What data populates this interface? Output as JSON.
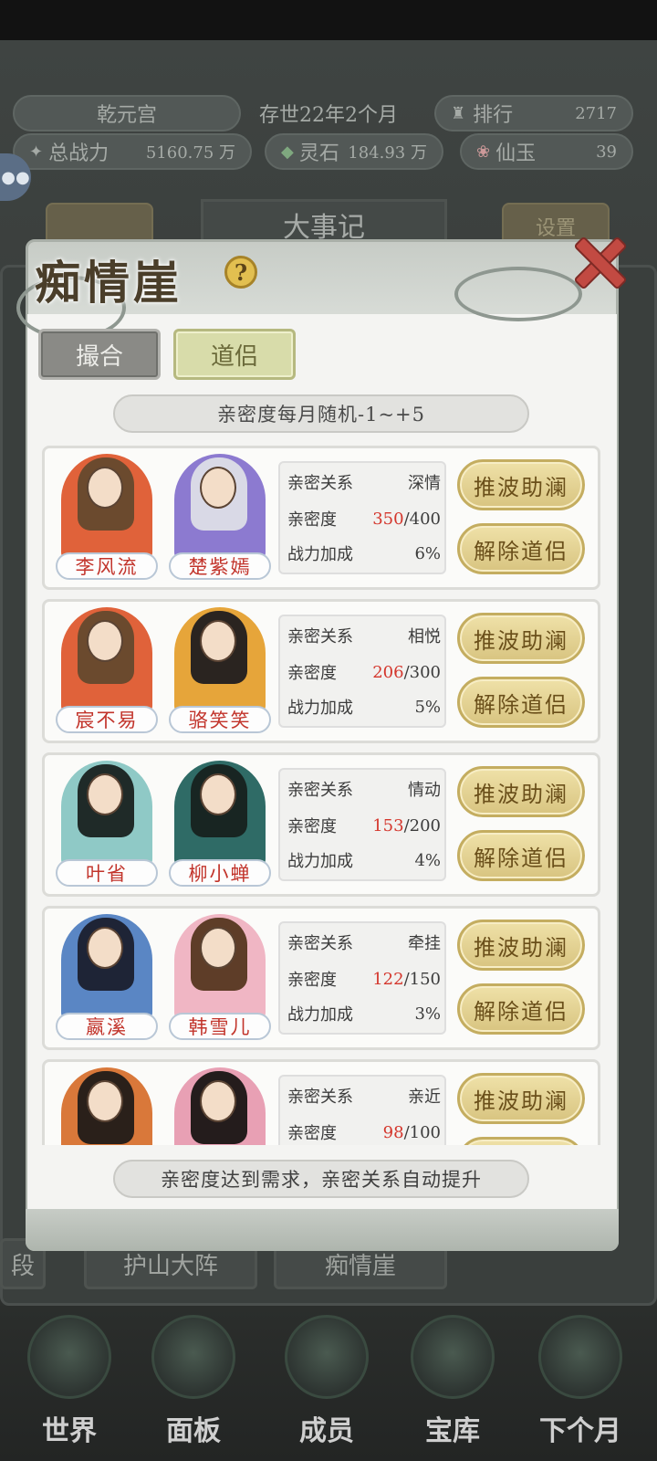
{
  "topbar": {
    "sect_name": "乾元宫",
    "era": "存世22年2个月",
    "rank_label": "排行",
    "rank_value": "2717",
    "power_label": "总战力",
    "power_value": "5160.75 万",
    "stone_label": "灵石",
    "stone_value": "184.93 万",
    "jade_label": "仙玉",
    "jade_value": "39"
  },
  "background": {
    "title": "大事记",
    "settings_label": "设置",
    "bottom_buttons": [
      "段",
      "护山大阵",
      "痴情崖"
    ]
  },
  "navbar": {
    "items": [
      {
        "label": "世界",
        "icon": "world-icon"
      },
      {
        "label": "面板",
        "icon": "panel-icon"
      },
      {
        "label": "成员",
        "icon": "members-icon"
      },
      {
        "label": "宝库",
        "icon": "treasury-icon"
      },
      {
        "label": "下个月",
        "icon": "next-month-icon"
      }
    ]
  },
  "dialog": {
    "title": "痴情崖",
    "help_glyph": "?",
    "tabs": [
      {
        "label": "撮合",
        "active": false
      },
      {
        "label": "道侣",
        "active": true
      }
    ],
    "info_banner": "亲密度每月随机-1~+5",
    "footer_note": "亲密度达到需求，亲密关系自动提升",
    "stat_labels": {
      "relation": "亲密关系",
      "intimacy": "亲密度",
      "power_bonus": "战力加成"
    },
    "buttons": {
      "boost": "推波助澜",
      "dissolve": "解除道侣"
    },
    "couples": [
      {
        "left_name": "李风流",
        "right_name": "楚紫嫣",
        "relation": "深情",
        "intimacy": "350",
        "intimacy_max": "/400",
        "bonus": "6%"
      },
      {
        "left_name": "宸不易",
        "right_name": "骆笑笑",
        "relation": "相悦",
        "intimacy": "206",
        "intimacy_max": "/300",
        "bonus": "5%"
      },
      {
        "left_name": "叶省",
        "right_name": "柳小蝉",
        "relation": "情动",
        "intimacy": "153",
        "intimacy_max": "/200",
        "bonus": "4%"
      },
      {
        "left_name": "嬴溪",
        "right_name": "韩雪儿",
        "relation": "牵挂",
        "intimacy": "122",
        "intimacy_max": "/150",
        "bonus": "3%"
      },
      {
        "left_name": "",
        "right_name": "",
        "relation": "亲近",
        "intimacy": "98",
        "intimacy_max": "/100",
        "bonus": ""
      }
    ]
  },
  "colors": {
    "name_red": "#c2342b",
    "intimacy_red": "#d4362c",
    "button_gold": "#d8c480",
    "tab_active": "#d8dcaa"
  }
}
